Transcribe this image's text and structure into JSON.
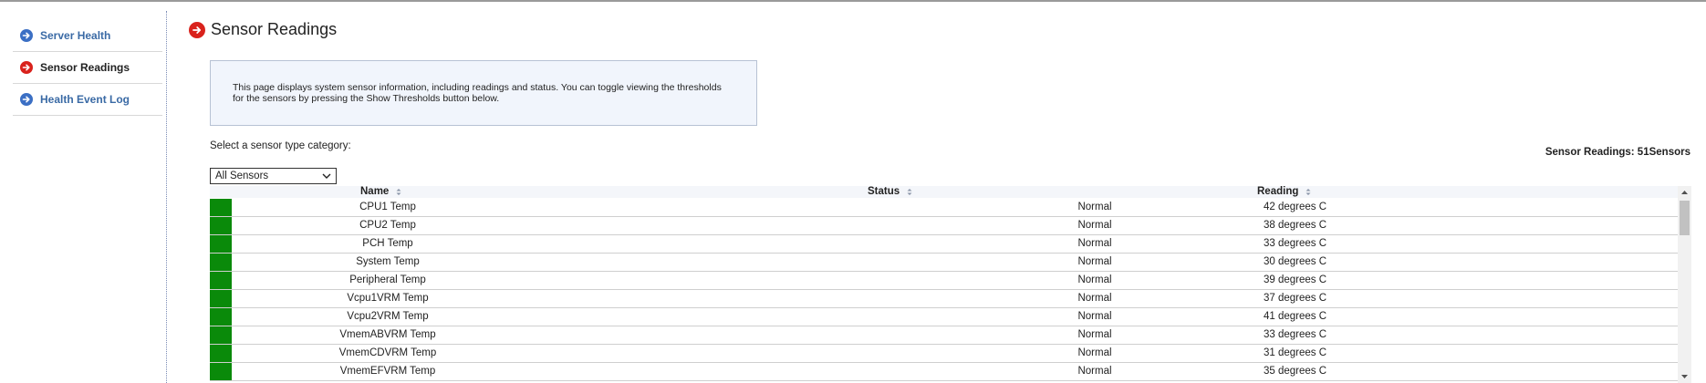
{
  "nav": {
    "items": [
      {
        "label": "Server Health",
        "icon": "arrow-right-circle-icon",
        "icon_color": "#3b6fc4",
        "active": false
      },
      {
        "label": "Sensor Readings",
        "icon": "arrow-right-circle-icon",
        "icon_color": "#d9221c",
        "active": true
      },
      {
        "label": "Health Event Log",
        "icon": "arrow-right-circle-icon",
        "icon_color": "#3b6fc4",
        "active": false
      }
    ]
  },
  "page": {
    "title": "Sensor Readings",
    "info_text": "This page displays system sensor information, including readings and status. You can toggle viewing the thresholds for the sensors by pressing the Show Thresholds button below.",
    "select_label": "Select a sensor type category:",
    "sensor_count": "Sensor Readings: 51Sensors",
    "category_selected": "All Sensors"
  },
  "table": {
    "columns": [
      "Name",
      "Status",
      "Reading"
    ],
    "rows": [
      {
        "name": "CPU1 Temp",
        "status": "Normal",
        "reading": "42 degrees C"
      },
      {
        "name": "CPU2 Temp",
        "status": "Normal",
        "reading": "38 degrees C"
      },
      {
        "name": "PCH Temp",
        "status": "Normal",
        "reading": "33 degrees C"
      },
      {
        "name": "System Temp",
        "status": "Normal",
        "reading": "30 degrees C"
      },
      {
        "name": "Peripheral Temp",
        "status": "Normal",
        "reading": "39 degrees C"
      },
      {
        "name": "Vcpu1VRM Temp",
        "status": "Normal",
        "reading": "37 degrees C"
      },
      {
        "name": "Vcpu2VRM Temp",
        "status": "Normal",
        "reading": "41 degrees C"
      },
      {
        "name": "VmemABVRM Temp",
        "status": "Normal",
        "reading": "33 degrees C"
      },
      {
        "name": "VmemCDVRM Temp",
        "status": "Normal",
        "reading": "31 degrees C"
      },
      {
        "name": "VmemEFVRM Temp",
        "status": "Normal",
        "reading": "35 degrees C"
      }
    ],
    "status_color": "#0a8a0a"
  }
}
